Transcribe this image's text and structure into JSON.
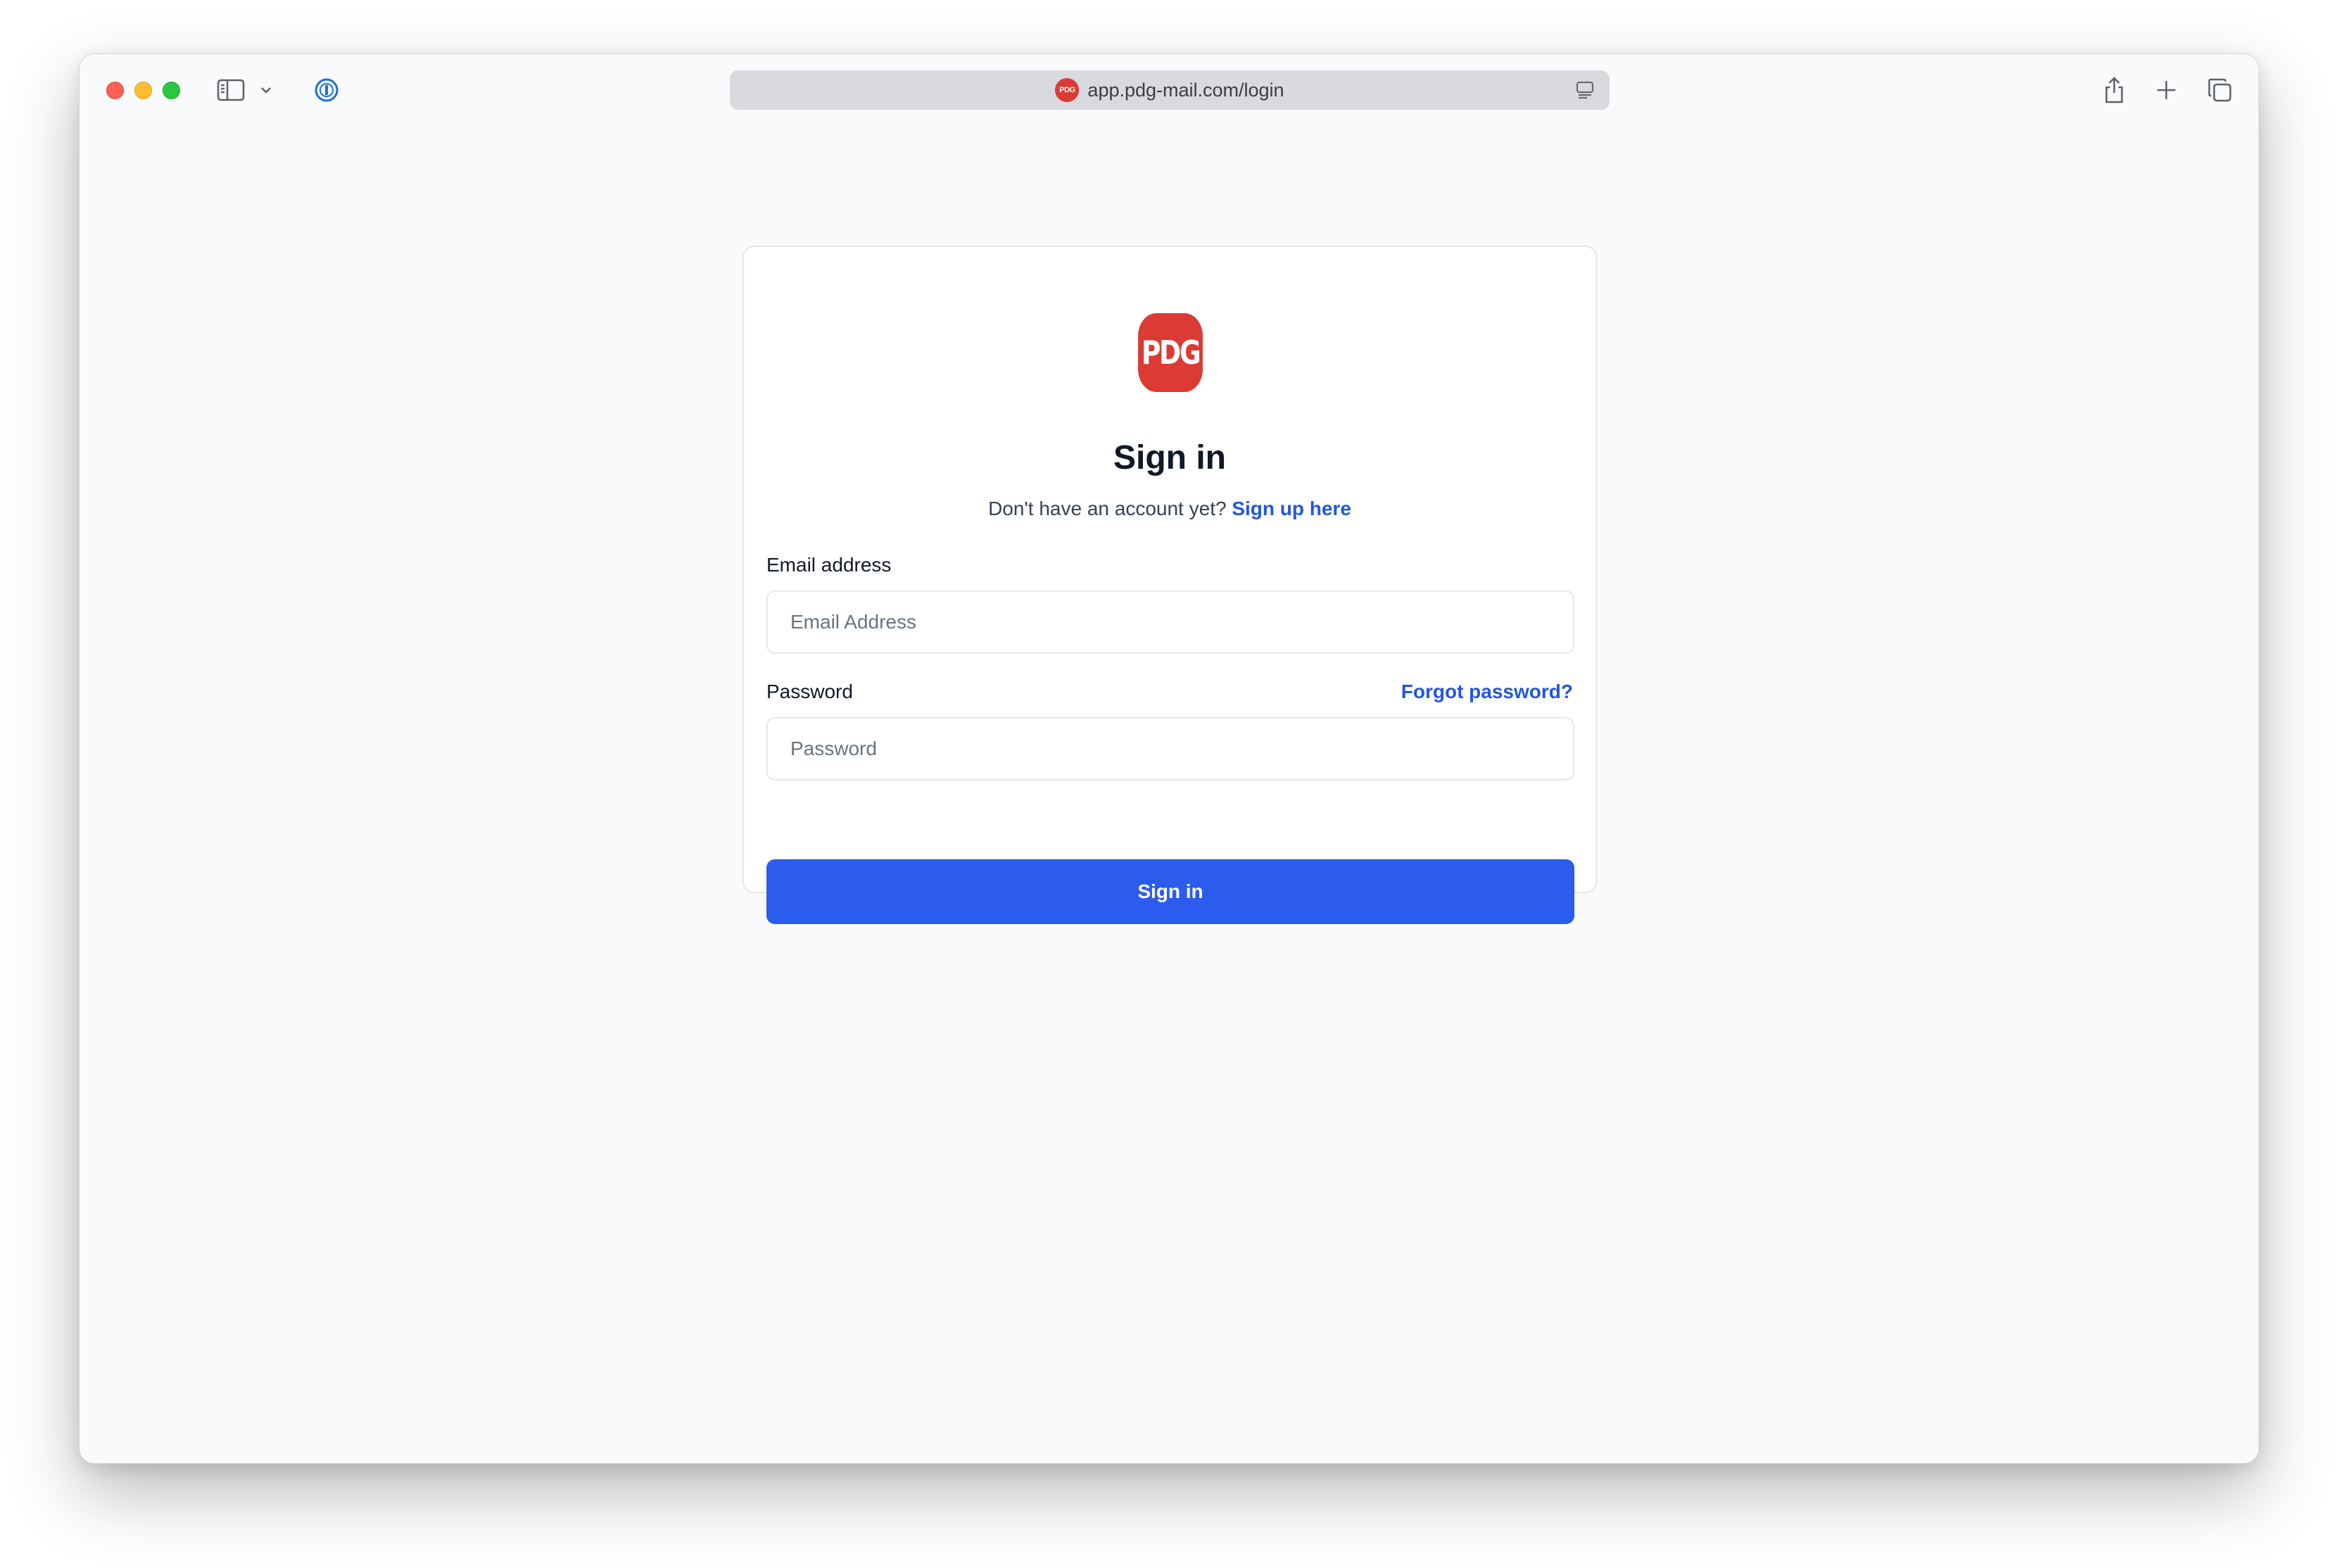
{
  "browser": {
    "url": "app.pdg-mail.com/login",
    "favicon_text": "PDG",
    "icons": {
      "sidebar": "sidebar-icon",
      "chevron": "chevron-down-icon",
      "password_manager": "password-manager-icon",
      "reader": "reader-icon",
      "share": "share-icon",
      "new_tab": "plus-icon",
      "tabs": "tab-overview-icon"
    }
  },
  "login": {
    "logo_text": "PDG",
    "title": "Sign in",
    "signup_prompt": "Don't have an account yet?",
    "signup_link": "Sign up here",
    "email_label": "Email address",
    "email_placeholder": "Email Address",
    "password_label": "Password",
    "forgot_link": "Forgot password?",
    "password_placeholder": "Password",
    "submit_label": "Sign in"
  },
  "colors": {
    "brand_red": "#dc3a34",
    "primary_blue": "#2b5ced",
    "link_blue": "#2356e0",
    "page_bg": "#f9fafb"
  }
}
